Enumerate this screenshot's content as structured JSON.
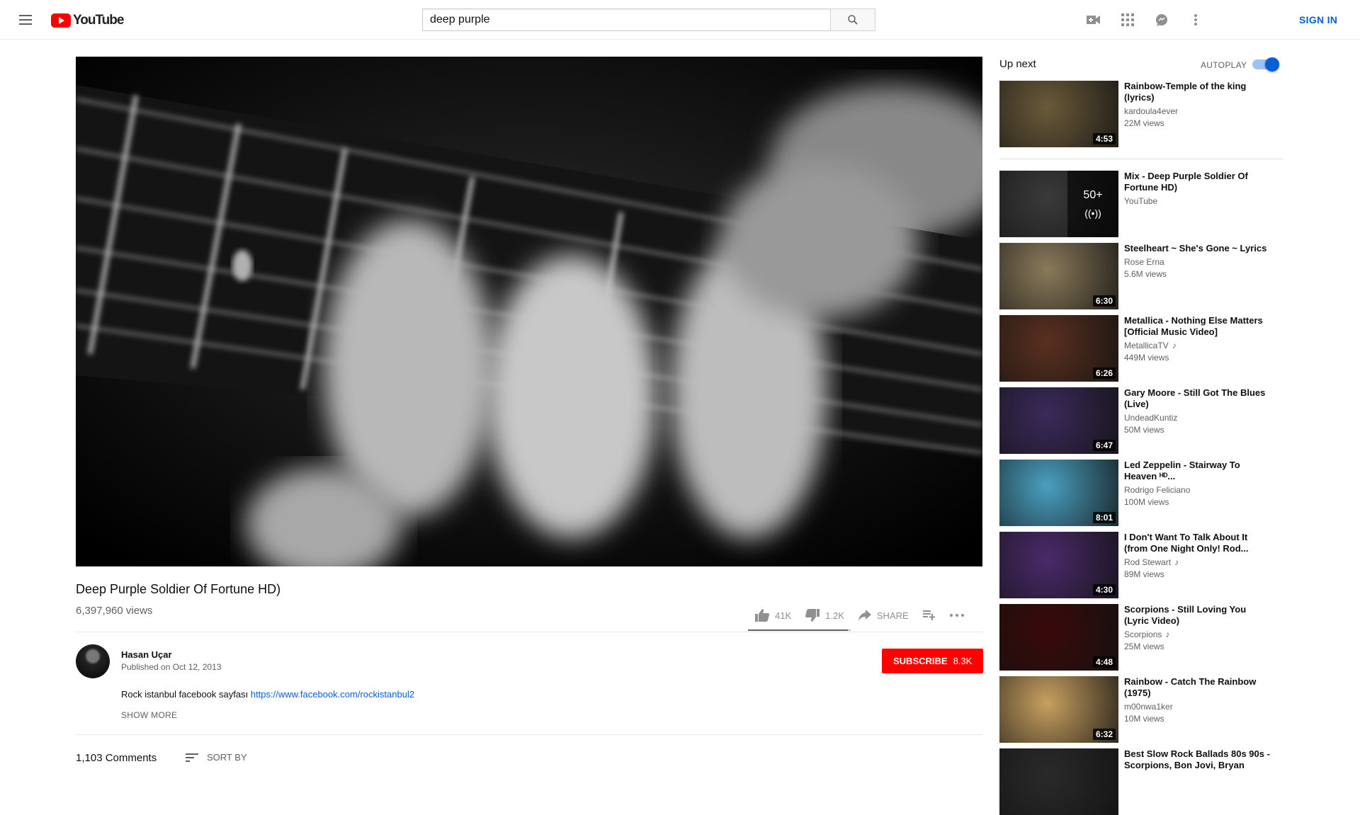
{
  "header": {
    "logo_text": "YouTube",
    "search_value": "deep purple",
    "sign_in": "SIGN IN",
    "icons": [
      "menu-icon",
      "create-video-icon",
      "apps-icon",
      "messages-icon",
      "more-vert-icon",
      "search-icon"
    ]
  },
  "video": {
    "title": "Deep Purple Soldier Of Fortune HD)",
    "views": "6,397,960 views",
    "likes": "41K",
    "dislikes": "1.2K",
    "share_label": "SHARE",
    "like_ratio": 0.97
  },
  "owner": {
    "name": "Hasan Uçar",
    "published": "Published on Oct 12, 2013",
    "subscribe_label": "SUBSCRIBE",
    "subscriber_count": "8.3K"
  },
  "description": {
    "text": "Rock istanbul facebook sayfası",
    "link": "https://www.facebook.com/rockistanbul2",
    "show_more": "SHOW MORE"
  },
  "comments": {
    "count": "1,103 Comments",
    "sort_label": "SORT BY"
  },
  "sidebar": {
    "up_next_label": "Up next",
    "autoplay_label": "AUTOPLAY",
    "autoplay_on": true,
    "items": [
      {
        "title": "Rainbow-Temple of the king (lyrics)",
        "channel": "kardoula4ever",
        "views": "22M views",
        "duration": "4:53",
        "thumb_color": "#6a5a3a"
      },
      {
        "title": "Mix - Deep Purple Soldier Of Fortune HD)",
        "channel": "YouTube",
        "views": "",
        "duration": "",
        "mix_count": "50+",
        "thumb_color": "#3a3a3a"
      },
      {
        "title": "Steelheart ~ She's Gone ~ Lyrics",
        "channel": "Rose Erna",
        "views": "5.6M views",
        "duration": "6:30",
        "thumb_color": "#8a7a5a"
      },
      {
        "title": "Metallica - Nothing Else Matters [Official Music Video]",
        "channel": "MetallicaTV",
        "views": "449M views",
        "duration": "6:26",
        "thumb_color": "#5a3020",
        "music_note": "♪"
      },
      {
        "title": "Gary Moore - Still Got The Blues (Live)",
        "channel": "UndeadKuntiz",
        "views": "50M views",
        "duration": "6:47",
        "thumb_color": "#3a2a5a"
      },
      {
        "title": "Led Zeppelin - Stairway To Heaven ᴴᴰ...",
        "channel": "Rodrigo Feliciano",
        "views": "100M views",
        "duration": "8:01",
        "thumb_color": "#4aa0c0"
      },
      {
        "title": "I Don't Want To Talk About It (from One Night Only! Rod...",
        "channel": "Rod Stewart",
        "views": "89M views",
        "duration": "4:30",
        "thumb_color": "#4a2a6a",
        "music_note": "♪"
      },
      {
        "title": "Scorpions - Still Loving You (Lyric Video)",
        "channel": "Scorpions",
        "views": "25M views",
        "duration": "4:48",
        "thumb_color": "#3a0a0a",
        "music_note": "♪"
      },
      {
        "title": "Rainbow - Catch The Rainbow (1975)",
        "channel": "m00nwa1ker",
        "views": "10M views",
        "duration": "6:32",
        "thumb_color": "#c8a060"
      },
      {
        "title": "Best Slow Rock Ballads 80s 90s - Scorpions, Bon Jovi, Bryan",
        "channel": "",
        "views": "",
        "duration": "",
        "thumb_color": "#2a2a2a"
      }
    ]
  }
}
